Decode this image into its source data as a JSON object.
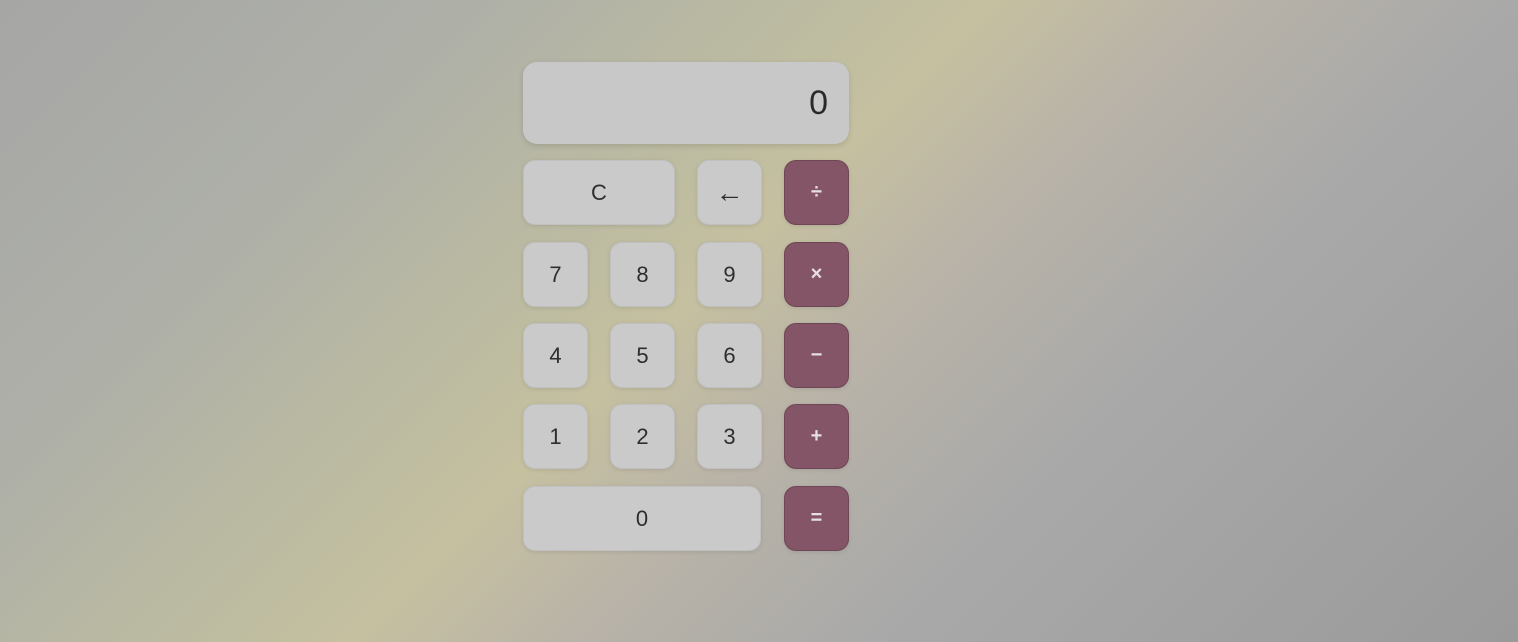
{
  "display": {
    "value": "0"
  },
  "keys": {
    "clear": "C",
    "backspace": "←",
    "divide": "÷",
    "seven": "7",
    "eight": "8",
    "nine": "9",
    "multiply": "×",
    "four": "4",
    "five": "5",
    "six": "6",
    "subtract": "−",
    "one": "1",
    "two": "2",
    "three": "3",
    "add": "+",
    "zero": "0",
    "equals": "="
  },
  "colors": {
    "operator": "#845566",
    "key": "#cacaca",
    "display": "#c8c8c8"
  }
}
